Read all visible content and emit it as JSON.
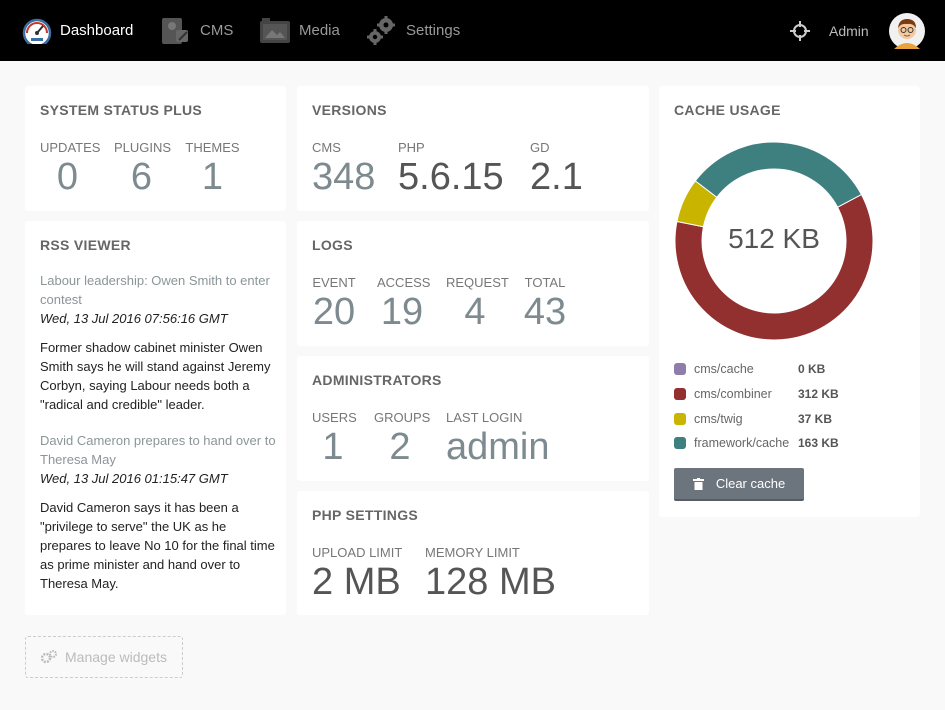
{
  "nav": {
    "items": [
      {
        "label": "Dashboard",
        "icon": "dashboard-gauge-icon",
        "active": true
      },
      {
        "label": "CMS",
        "icon": "cms-icon",
        "active": false
      },
      {
        "label": "Media",
        "icon": "media-icon",
        "active": false
      },
      {
        "label": "Settings",
        "icon": "gear-icon",
        "active": false
      }
    ],
    "admin_label": "Admin"
  },
  "system_status": {
    "title": "SYSTEM STATUS PLUS",
    "stats": [
      {
        "label": "UPDATES",
        "value": "0"
      },
      {
        "label": "PLUGINS",
        "value": "6"
      },
      {
        "label": "THEMES",
        "value": "1"
      }
    ]
  },
  "versions": {
    "title": "VERSIONS",
    "stats": [
      {
        "label": "CMS",
        "value": "348"
      },
      {
        "label": "PHP",
        "value": "5.6.15"
      },
      {
        "label": "GD",
        "value": "2.1"
      }
    ]
  },
  "cache": {
    "title": "CACHE USAGE",
    "total": "512 KB",
    "items": [
      {
        "name": "cms/cache",
        "size": "0 KB",
        "kb": 0,
        "color": "#8e7dab"
      },
      {
        "name": "cms/combiner",
        "size": "312 KB",
        "kb": 312,
        "color": "#922f2f"
      },
      {
        "name": "cms/twig",
        "size": "37 KB",
        "kb": 37,
        "color": "#c9b400"
      },
      {
        "name": "framework/cache",
        "size": "163 KB",
        "kb": 163,
        "color": "#3e8080"
      }
    ],
    "clear_label": "Clear cache"
  },
  "rss": {
    "title": "RSS VIEWER",
    "items": [
      {
        "headline": "Labour leadership: Owen Smith to enter contest",
        "date": "Wed, 13 Jul 2016 07:56:16 GMT",
        "body": "Former shadow cabinet minister Owen Smith says he will stand against Jeremy Corbyn, saying Labour needs both a \"radical and credible\" leader."
      },
      {
        "headline": "David Cameron prepares to hand over to Theresa May",
        "date": "Wed, 13 Jul 2016 01:15:47 GMT",
        "body": "David Cameron says it has been a \"privilege to serve\" the UK as he prepares to leave No 10 for the final time as prime minister and hand over to Theresa May."
      }
    ]
  },
  "logs": {
    "title": "LOGS",
    "stats": [
      {
        "label": "EVENT",
        "value": "20"
      },
      {
        "label": "ACCESS",
        "value": "19"
      },
      {
        "label": "REQUEST",
        "value": "4"
      },
      {
        "label": "TOTAL",
        "value": "43"
      }
    ]
  },
  "administrators": {
    "title": "ADMINISTRATORS",
    "stats": [
      {
        "label": "USERS",
        "value": "1"
      },
      {
        "label": "GROUPS",
        "value": "2"
      },
      {
        "label": "LAST LOGIN",
        "value": "admin"
      }
    ]
  },
  "php_settings": {
    "title": "PHP SETTINGS",
    "stats": [
      {
        "label": "UPLOAD LIMIT",
        "value": "2 MB"
      },
      {
        "label": "MEMORY LIMIT",
        "value": "128 MB"
      }
    ]
  },
  "manage_widgets_label": "Manage widgets"
}
